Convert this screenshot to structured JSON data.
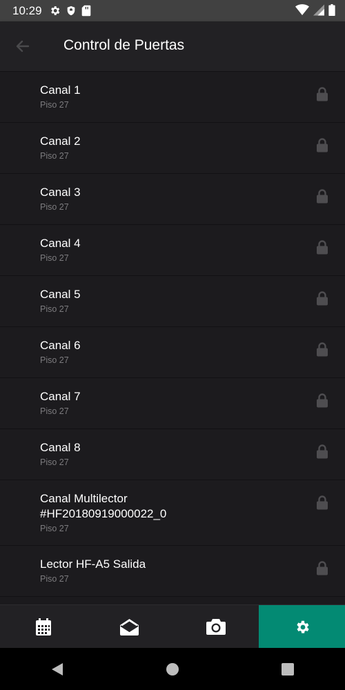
{
  "status_bar": {
    "time": "10:29",
    "left_icons": [
      "gear-icon",
      "shield-icon",
      "sd-card-icon"
    ],
    "right_icons": [
      "wifi-icon",
      "signal-icon",
      "battery-icon"
    ]
  },
  "app_bar": {
    "title": "Control de Puertas",
    "back_icon": "arrow-left-icon"
  },
  "doors": [
    {
      "title": "Canal 1",
      "floor": "Piso 27"
    },
    {
      "title": "Canal 2",
      "floor": "Piso 27"
    },
    {
      "title": "Canal 3",
      "floor": "Piso 27"
    },
    {
      "title": "Canal 4",
      "floor": "Piso 27"
    },
    {
      "title": "Canal 5",
      "floor": "Piso 27"
    },
    {
      "title": "Canal 6",
      "floor": "Piso 27"
    },
    {
      "title": "Canal 7",
      "floor": "Piso 27"
    },
    {
      "title": "Canal 8",
      "floor": "Piso 27"
    },
    {
      "title": "Canal Multilector\n#HF20180919000022_0",
      "floor": "Piso 27"
    },
    {
      "title": "Lector HF-A5 Salida",
      "floor": "Piso 27"
    }
  ],
  "bottom_nav": {
    "tabs": [
      {
        "icon": "calendar-icon",
        "active": false
      },
      {
        "icon": "envelope-open-icon",
        "active": false
      },
      {
        "icon": "camera-icon",
        "active": false
      },
      {
        "icon": "gear-icon",
        "active": true
      }
    ],
    "active_color": "#038a73"
  },
  "system_nav": [
    "back-triangle-icon",
    "home-circle-icon",
    "recents-square-icon"
  ]
}
